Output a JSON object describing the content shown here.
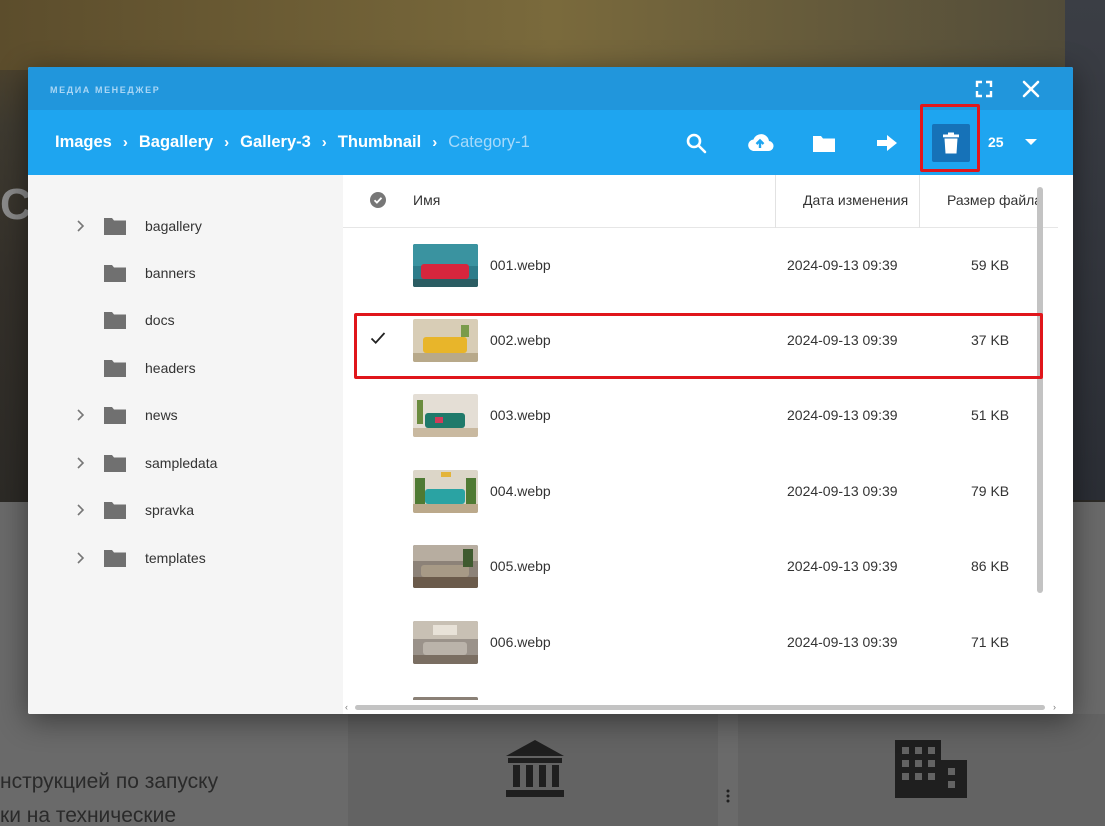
{
  "background": {
    "text_line1": "нструкцией по запуску",
    "text_line2": "ки на технические",
    "hero_letter": "С",
    "icons": [
      "bank-icon",
      "building-icon",
      "kebab-menu-icon"
    ]
  },
  "modal": {
    "title": "МЕДИА МЕНЕДЖЕР",
    "titlebar_icons": [
      "fullscreen-icon",
      "close-icon"
    ],
    "breadcrumbs": [
      "Images",
      "Bagallery",
      "Gallery-3",
      "Thumbnail",
      "Category-1"
    ],
    "toolbar_icons": [
      "search-icon",
      "upload-icon",
      "new-folder-icon",
      "move-icon",
      "trash-icon"
    ],
    "per_page": "25",
    "colors": {
      "titlebar": "#2196dc",
      "toolbar": "#1ea5f0",
      "highlight": "#e0161b"
    }
  },
  "sidebar": {
    "folders": [
      {
        "label": "bagallery",
        "expandable": true
      },
      {
        "label": "banners",
        "expandable": false
      },
      {
        "label": "docs",
        "expandable": false
      },
      {
        "label": "headers",
        "expandable": false
      },
      {
        "label": "news",
        "expandable": true
      },
      {
        "label": "sampledata",
        "expandable": true
      },
      {
        "label": "spravka",
        "expandable": true
      },
      {
        "label": "templates",
        "expandable": true
      }
    ]
  },
  "table": {
    "headers": {
      "name": "Имя",
      "date": "Дата изменения",
      "size": "Размер файла"
    },
    "rows": [
      {
        "name": "001.webp",
        "date": "2024-09-13 09:39",
        "size": "59 KB",
        "selected": false
      },
      {
        "name": "002.webp",
        "date": "2024-09-13 09:39",
        "size": "37 KB",
        "selected": true
      },
      {
        "name": "003.webp",
        "date": "2024-09-13 09:39",
        "size": "51 KB",
        "selected": false
      },
      {
        "name": "004.webp",
        "date": "2024-09-13 09:39",
        "size": "79 KB",
        "selected": false
      },
      {
        "name": "005.webp",
        "date": "2024-09-13 09:39",
        "size": "86 KB",
        "selected": false
      },
      {
        "name": "006.webp",
        "date": "2024-09-13 09:39",
        "size": "71 KB",
        "selected": false
      }
    ]
  }
}
